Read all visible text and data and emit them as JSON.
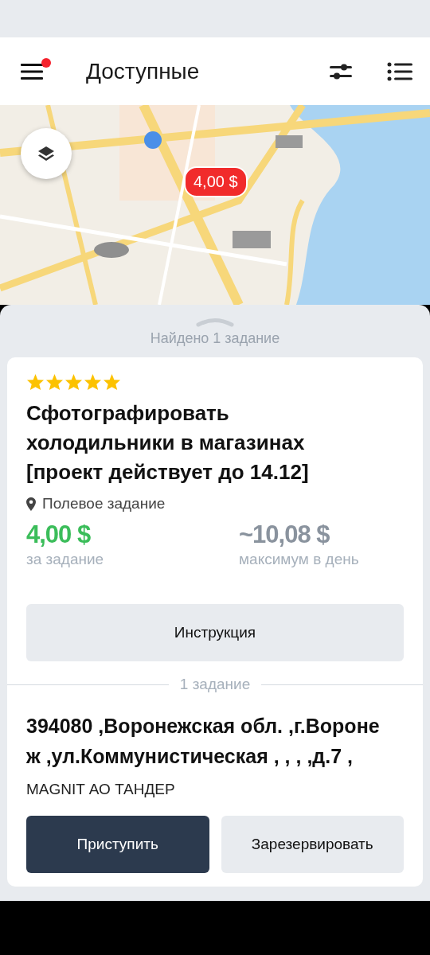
{
  "header": {
    "title": "Доступные",
    "menu_notification": true
  },
  "map": {
    "kind": "picture",
    "pin_price": "4,00 $"
  },
  "panel": {
    "found": "Найдено 1 задание"
  },
  "task": {
    "stars": 5,
    "title": "Сфотографировать холодильники в магазинах [проект действует до 14.12]",
    "location_type": "Полевое задание",
    "price": "4,00 $",
    "price_caption": "за задание",
    "max_per_day": "~10,08 $",
    "max_caption": "максимум в день",
    "instruction_button": "Инструкция",
    "count_divider": "1 задание",
    "address": "394080 ,Воронежская обл. ,г.Воронеж ,ул.Коммунистическая , , , ,д.7 ,",
    "company": "MAGNIT АО ТАНДЕР",
    "buttons": [
      {
        "label": "Приступить",
        "kind": "primary"
      },
      {
        "label": "Зарезервировать",
        "kind": "secondary"
      }
    ]
  }
}
